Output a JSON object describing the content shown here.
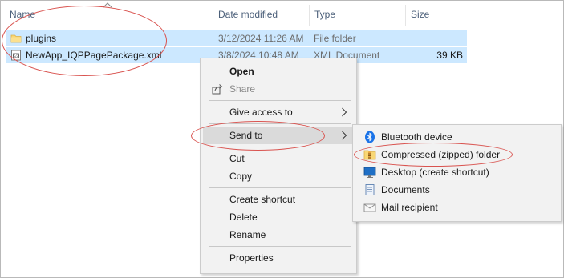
{
  "columns": {
    "name": "Name",
    "date": "Date modified",
    "type": "Type",
    "size": "Size"
  },
  "files": [
    {
      "name": "plugins",
      "date": "3/12/2024 11:26 AM",
      "type": "File folder",
      "size": "",
      "icon": "folder-icon"
    },
    {
      "name": "NewApp_IQPPagePackage.xml",
      "date": "3/8/2024 10:48 AM",
      "type": "XML Document",
      "size": "39 KB",
      "icon": "xml-file-icon"
    }
  ],
  "context_menu": {
    "open": "Open",
    "share": "Share",
    "give_access": "Give access to",
    "send_to": "Send to",
    "cut": "Cut",
    "copy": "Copy",
    "create_shortcut": "Create shortcut",
    "delete": "Delete",
    "rename": "Rename",
    "properties": "Properties"
  },
  "send_to_menu": {
    "bluetooth": "Bluetooth device",
    "compressed": "Compressed (zipped) folder",
    "desktop": "Desktop (create shortcut)",
    "documents": "Documents",
    "mail": "Mail recipient"
  },
  "colors": {
    "selection": "#cce8ff",
    "annotation": "#d9534f",
    "menu_bg": "#f2f2f2",
    "menu_highlight": "#dadada"
  }
}
